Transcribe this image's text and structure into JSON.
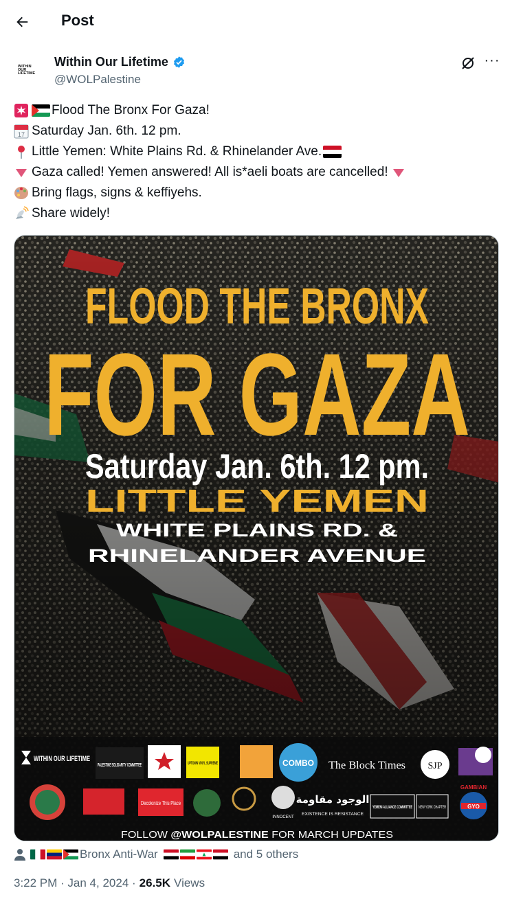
{
  "header": {
    "title": "Post"
  },
  "author": {
    "name": "Within Our Lifetime",
    "handle": "@WOLPalestine",
    "avatar_text": "WITHIN OUR LIFETIME"
  },
  "post": {
    "lines": [
      "Flood The Bronx For Gaza!",
      "Saturday Jan. 6th. 12 pm.",
      "Little Yemen: White Plains Rd. & Rhinelander Ave.",
      "Gaza called! Yemen answered! All is*aeli boats are cancelled!",
      "Bring flags, signs & keffiyehs.",
      "Share widely!"
    ],
    "calendar_icon_text": "JUL 17"
  },
  "poster": {
    "headline_1": "FLOOD THE BRONX",
    "headline_2": "FOR GAZA",
    "date_line": "Saturday Jan. 6th. 12 pm.",
    "location_line": "LITTLE YEMEN",
    "address_1": "WHITE PLAINS RD. &",
    "address_2": "RHINELANDER AVENUE",
    "footer_prefix": "FOLLOW ",
    "footer_handle": "@WOLPALESTINE",
    "footer_suffix": " FOR MARCH UPDATES",
    "logos_row1": [
      "WITHIN OUR LIFETIME",
      "PALESTINE SOLIDARITY COMMITTEE",
      "UPTOWN VINYL SUPREME",
      "COMBO",
      "The Block Times",
      "SJP"
    ],
    "logos_row2": [
      "Decolonize This Place",
      "INNOCENT",
      "الوجود مقاومة",
      "EXISTENCE IS RESISTANCE",
      "YEMENI ALLIANCE COMMITTEE",
      "NEW YORK CHAPTER",
      "GAMBIAN",
      "GYO"
    ],
    "accent_yellow": "#efb02d"
  },
  "tags": {
    "text": "Bronx Anti-War",
    "suffix": "and 5 others"
  },
  "timestamp": {
    "time": "3:22 PM · Jan 4, 2024 · ",
    "views_count": "26.5K",
    "views_label": "Views"
  }
}
